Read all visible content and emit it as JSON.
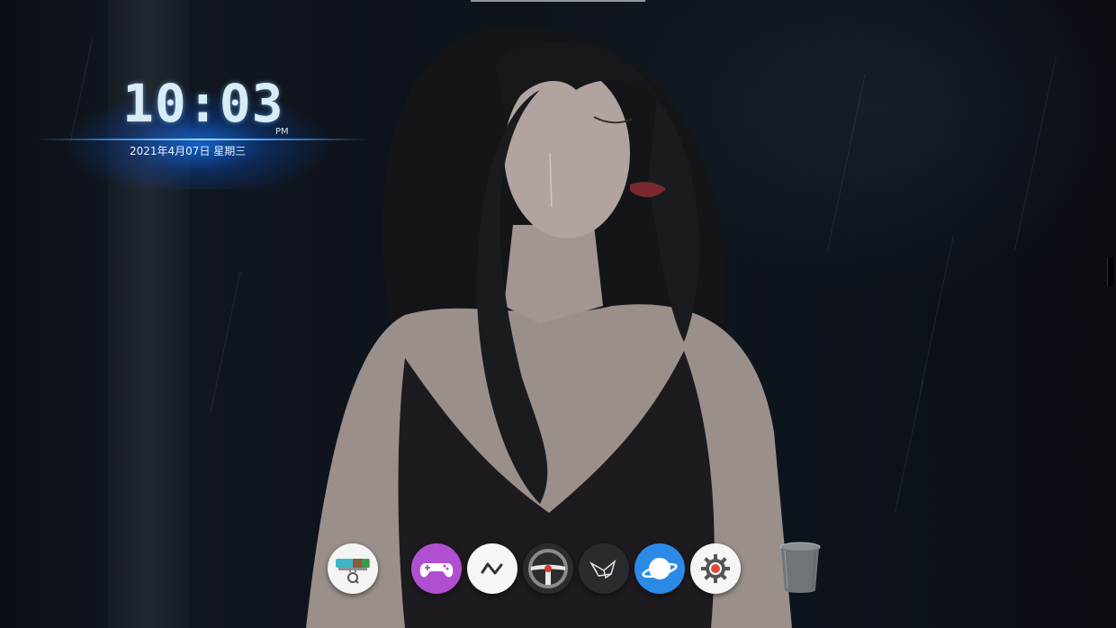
{
  "clock": {
    "time": "10:03",
    "ampm": "PM",
    "date": "2021年4月07日 星期三"
  },
  "dock": {
    "items": [
      {
        "name": "File Manager",
        "icon": "finder-icon"
      },
      {
        "name": "Game Center",
        "icon": "gamepad-icon"
      },
      {
        "name": "System Monitor",
        "icon": "pulse-icon"
      },
      {
        "name": "Drive",
        "icon": "steering-wheel-icon"
      },
      {
        "name": "Origami",
        "icon": "paper-crane-icon"
      },
      {
        "name": "Browser",
        "icon": "planet-icon"
      },
      {
        "name": "Settings",
        "icon": "gear-icon"
      },
      {
        "name": "Trash",
        "icon": "trash-icon"
      }
    ],
    "active_item": "Browser"
  },
  "colors": {
    "clock_glow": "#1478ff",
    "clock_text": "#d7ecf6",
    "game_icon_bg": "#b04fd0",
    "browser_icon_bg": "#2b8ae6",
    "settings_accent": "#e04a3a"
  }
}
